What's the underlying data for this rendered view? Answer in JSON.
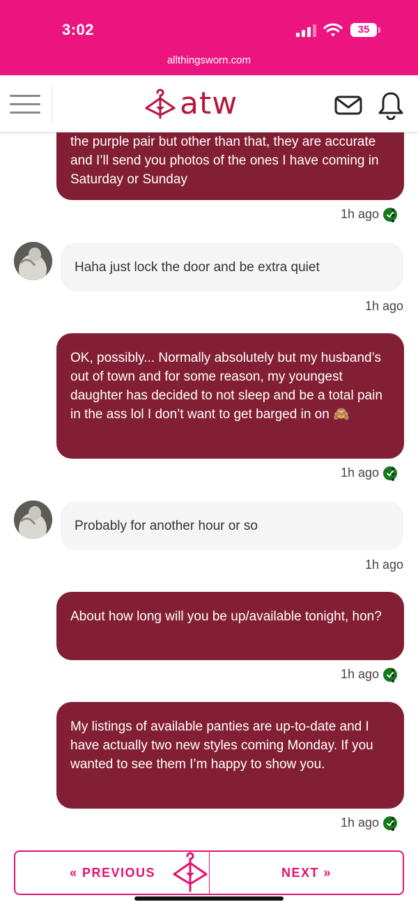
{
  "status": {
    "time": "3:02",
    "battery": "35"
  },
  "browser": {
    "url": "allthingsworn.com"
  },
  "header": {
    "logo_text": "atw",
    "brand_color": "#b5173f",
    "bar_color": "#ec1580"
  },
  "messages": [
    {
      "direction": "out",
      "text": "the purple pair but other than that, they are accurate and I’ll send you photos of the ones I have coming in Saturday or Sunday",
      "time": "1h ago",
      "read": true
    },
    {
      "direction": "in",
      "text": "Haha just lock the door and be extra quiet",
      "time": "1h ago"
    },
    {
      "direction": "out",
      "text": "OK, possibly... Normally absolutely but my husband’s out of town and for some reason, my youngest daughter has decided to not sleep and be a total pain in the ass lol I don’t want to get barged in on 🙈",
      "time": "1h ago",
      "read": true
    },
    {
      "direction": "in",
      "text": "Probably for another hour or so",
      "time": "1h ago"
    },
    {
      "direction": "out",
      "text": "About how long will you be up/available tonight, hon?",
      "time": "1h ago",
      "read": true
    },
    {
      "direction": "out",
      "text": "My listings of available panties are up-to-date and I have actually two new styles coming Monday. If you wanted to see them I’m happy to show you.",
      "time": "1h ago",
      "read": true
    }
  ],
  "pager": {
    "prev_label": "« PREVIOUS",
    "next_label": "NEXT »",
    "accent": "#e2126f"
  }
}
